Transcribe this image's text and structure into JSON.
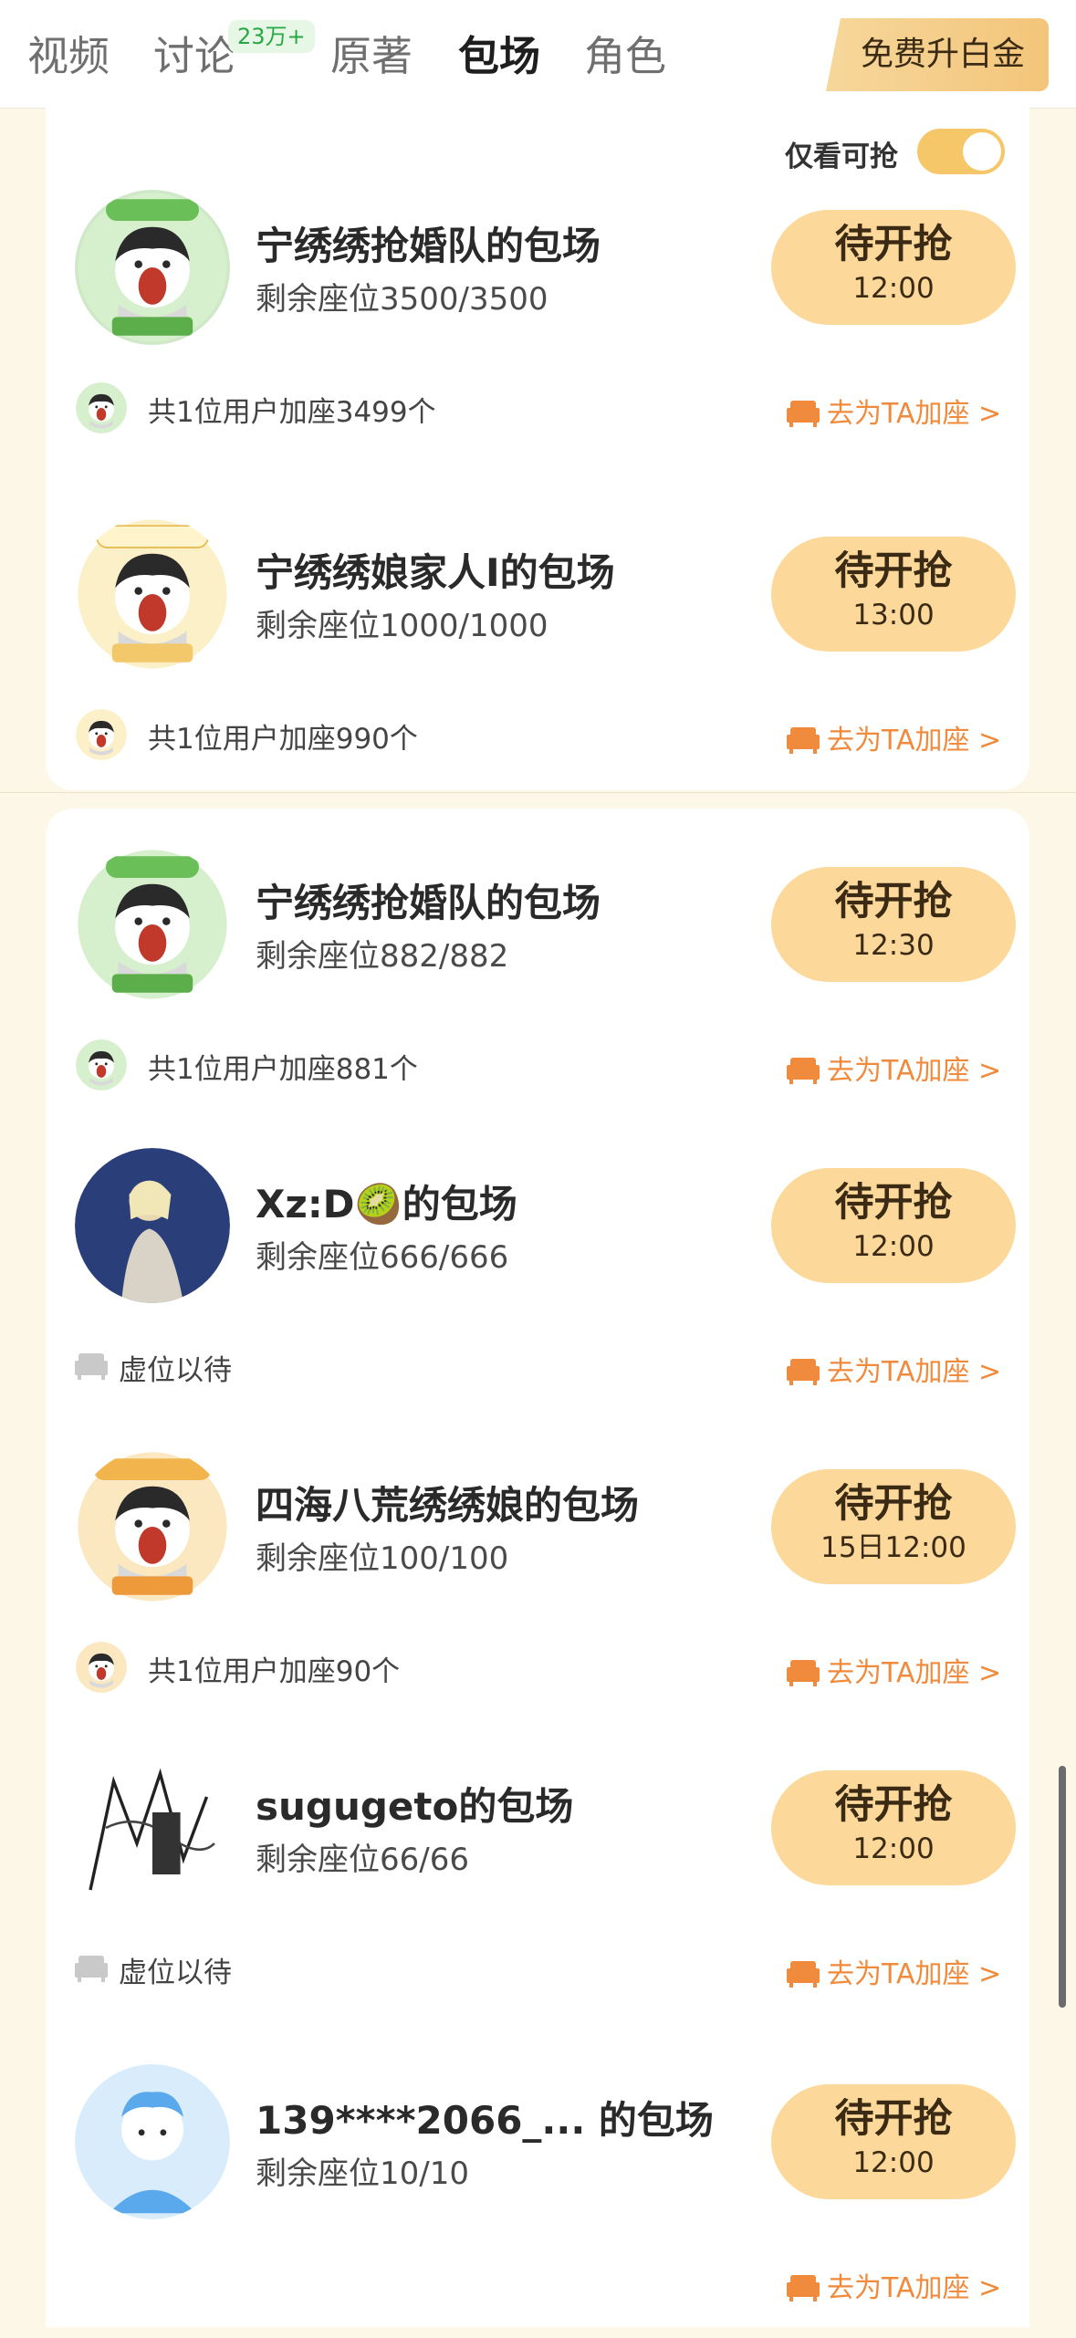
{
  "tabs": [
    {
      "label": "视频",
      "active": false
    },
    {
      "label": "讨论",
      "active": false,
      "badge": "23万+"
    },
    {
      "label": "原著",
      "active": false
    },
    {
      "label": "包场",
      "active": true
    },
    {
      "label": "角色",
      "active": false
    }
  ],
  "upgrade_label": "免费升白金",
  "filter": {
    "label": "仅看可抢",
    "on": true
  },
  "colors": {
    "accent": "#f08a3c",
    "button": "#fcd99b",
    "toggle": "#f6c768",
    "background": "#fdf7e8"
  },
  "grab_label": "待开抢",
  "add_link_label": "去为TA加座 >",
  "items": [
    {
      "title": "宁绣绣抢婚队的包场",
      "seats": "剩余座位3500/3500",
      "time": "12:00",
      "added": "共1位用户加座3499个",
      "avatar": "cartoon-green-icon"
    },
    {
      "title": "宁绣绣娘家人I的包场",
      "seats": "剩余座位1000/1000",
      "time": "13:00",
      "added": "共1位用户加座990个",
      "avatar": "cartoon-yellow-icon"
    },
    {
      "title": "宁绣绣抢婚队的包场",
      "seats": "剩余座位882/882",
      "time": "12:30",
      "added": "共1位用户加座881个",
      "avatar": "cartoon-green-icon"
    },
    {
      "title": "Xz:D🥝的包场",
      "seats": "剩余座位666/666",
      "time": "12:00",
      "added": "虚位以待",
      "avatar": "photo-blue-icon"
    },
    {
      "title": "四海八荒绣绣娘的包场",
      "seats": "剩余座位100/100",
      "time": "15日12:00",
      "added": "共1位用户加座90个",
      "avatar": "cartoon-orange-icon"
    },
    {
      "title": "sugugeto的包场",
      "seats": "剩余座位66/66",
      "time": "12:00",
      "added": "虚位以待",
      "avatar": "sketch-icon"
    },
    {
      "title": "139****2066_... 的包场",
      "seats": "剩余座位10/10",
      "time": "12:00",
      "added": "",
      "avatar": "default-user-icon"
    }
  ]
}
